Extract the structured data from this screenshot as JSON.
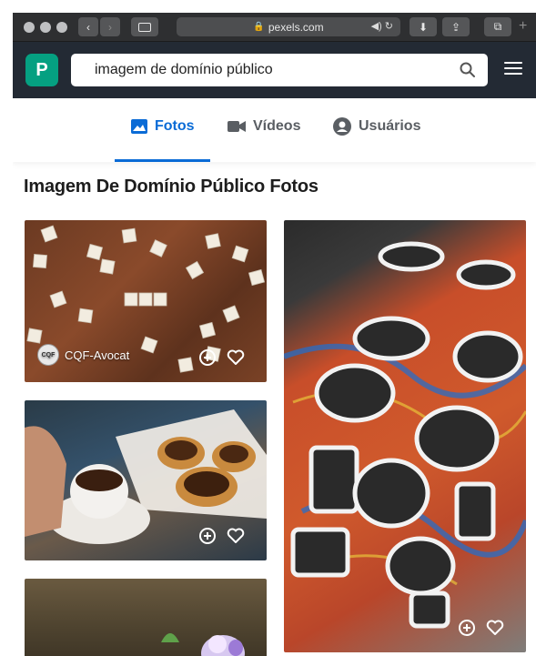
{
  "browser": {
    "url": "pexels.com",
    "url_lock_icon": "lock-icon",
    "audio_icon": "speaker-icon",
    "reload_icon": "reload-icon",
    "add_tab": "+"
  },
  "header": {
    "logo_letter": "P",
    "search_value": "imagem de domínio público",
    "search_icon": "search-icon",
    "menu_icon": "hamburger-icon"
  },
  "tabs": [
    {
      "label": "Fotos",
      "icon": "photo-icon",
      "active": true
    },
    {
      "label": "Vídeos",
      "icon": "video-camera-icon",
      "active": false
    },
    {
      "label": "Usuários",
      "icon": "user-icon",
      "active": false
    }
  ],
  "page_title": "Imagem De Domínio Público Fotos",
  "photos": {
    "scrabble": {
      "author": "CQF-Avocat",
      "avatar_text": "CQF",
      "tiles": [
        "Q",
        "I",
        "F",
        "T",
        "O",
        "A",
        "L",
        "A",
        "W",
        "E",
        "R",
        "N",
        "I",
        "T",
        "O",
        "U",
        "S",
        "Q"
      ]
    },
    "coffee": {},
    "letters": {}
  },
  "colors": {
    "brand": "#05a081",
    "header_bg": "#232a34",
    "active_tab": "#0a6bd6"
  }
}
